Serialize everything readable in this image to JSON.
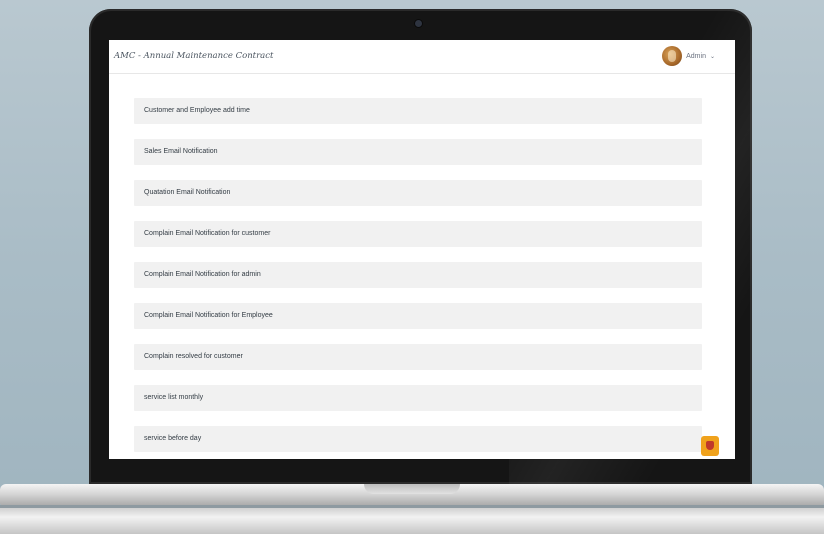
{
  "app": {
    "title": "AMC - Annual Maintenance Contract",
    "user_name": "Admin",
    "user_caret": "⌄"
  },
  "settings_list": [
    {
      "label": "Customer and Employee add time"
    },
    {
      "label": "Sales Email Notification"
    },
    {
      "label": "Quatation Email Notification"
    },
    {
      "label": "Complain Email Notification for customer"
    },
    {
      "label": "Complain Email Notification for admin"
    },
    {
      "label": "Complain Email Notification for Employee"
    },
    {
      "label": "Complain resolved for customer"
    },
    {
      "label": "service list monthly"
    },
    {
      "label": "service before day"
    }
  ],
  "colors": {
    "accent_badge": "#f0a21c",
    "row_background": "#f1f1f1"
  }
}
